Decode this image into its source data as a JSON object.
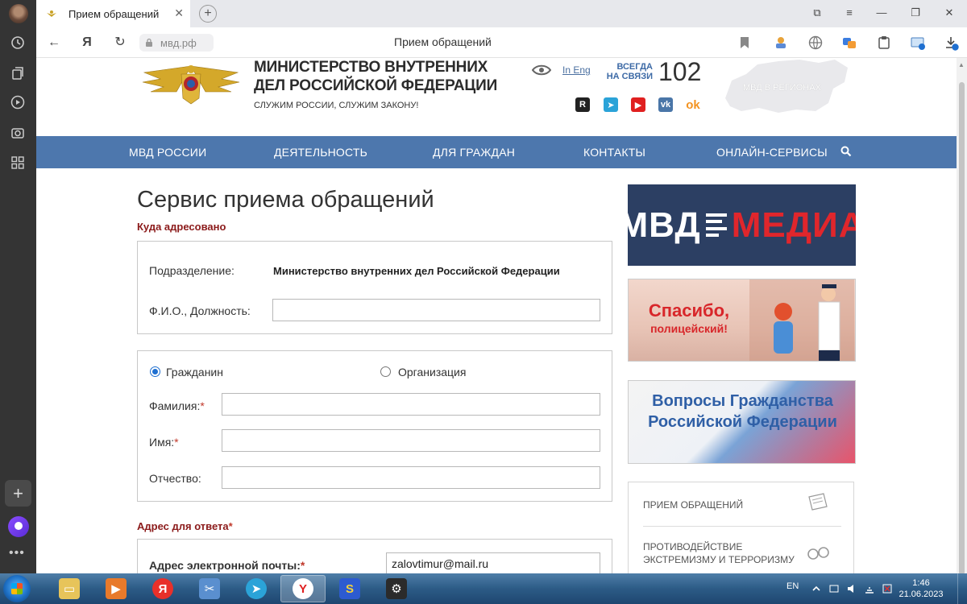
{
  "browser": {
    "tab_title": "Прием обращений",
    "url": "мвд.рф",
    "page_title": "Прием обращений",
    "download_badge": "1"
  },
  "site": {
    "title": "МИНИСТЕРСТВО ВНУТРЕННИХ ДЕЛ РОССИЙСКОЙ ФЕДЕРАЦИИ",
    "motto": "СЛУЖИМ РОССИИ, СЛУЖИМ ЗАКОНУ!",
    "lang_link": "In Eng",
    "hotline_label": "ВСЕГДА НА СВЯЗИ",
    "hotline_number": "102",
    "regions_label": "МВД В РЕГИОНАХ",
    "socials": [
      "rutube-icon",
      "telegram-icon",
      "youtube-icon",
      "vk-icon",
      "odnoklassniki-icon"
    ]
  },
  "nav": {
    "items": [
      "МВД РОССИИ",
      "ДЕЯТЕЛЬНОСТЬ",
      "ДЛЯ ГРАЖДАН",
      "КОНТАКТЫ",
      "ОНЛАЙН-СЕРВИСЫ"
    ]
  },
  "form": {
    "heading": "Сервис приема обращений",
    "addressed_title": "Куда адресовано",
    "division_label": "Подразделение:",
    "division_value": "Министерство внутренних дел Российской Федерации",
    "fio_label": "Ф.И.О., Должность:",
    "fio_value": "",
    "radio_citizen": "Гражданин",
    "radio_org": "Организация",
    "radio_selected": "Гражданин",
    "surname_label": "Фамилия:",
    "name_label": "Имя:",
    "patronymic_label": "Отчество:",
    "surname_value": "",
    "name_value": "",
    "patronymic_value": "",
    "reply_title": "Адрес для ответа",
    "email_label": "Адрес электронной почты:",
    "email_value": "zalovtimur@mail.ru",
    "required_mark": "*"
  },
  "sidebar": {
    "media_banner_left": "МВД",
    "media_banner_right": "МЕДИА",
    "thanks_line1": "Спасибо,",
    "thanks_line2": "полицейский!",
    "citizenship_text": "Вопросы Гражданства Российской Федерации",
    "menu": [
      "ПРИЕМ ОБРАЩЕНИЙ",
      "ПРОТИВОДЕЙСТВИЕ ЭКСТРЕМИЗМУ И ТЕРРОРИЗМУ"
    ]
  },
  "taskbar": {
    "lang": "EN",
    "time": "1:46",
    "date": "21.06.2023"
  },
  "colors": {
    "nav_blue": "#4d77ad",
    "section_red": "#8b1a1a",
    "media_bg": "#2c3f63",
    "media_red": "#e0262c"
  }
}
